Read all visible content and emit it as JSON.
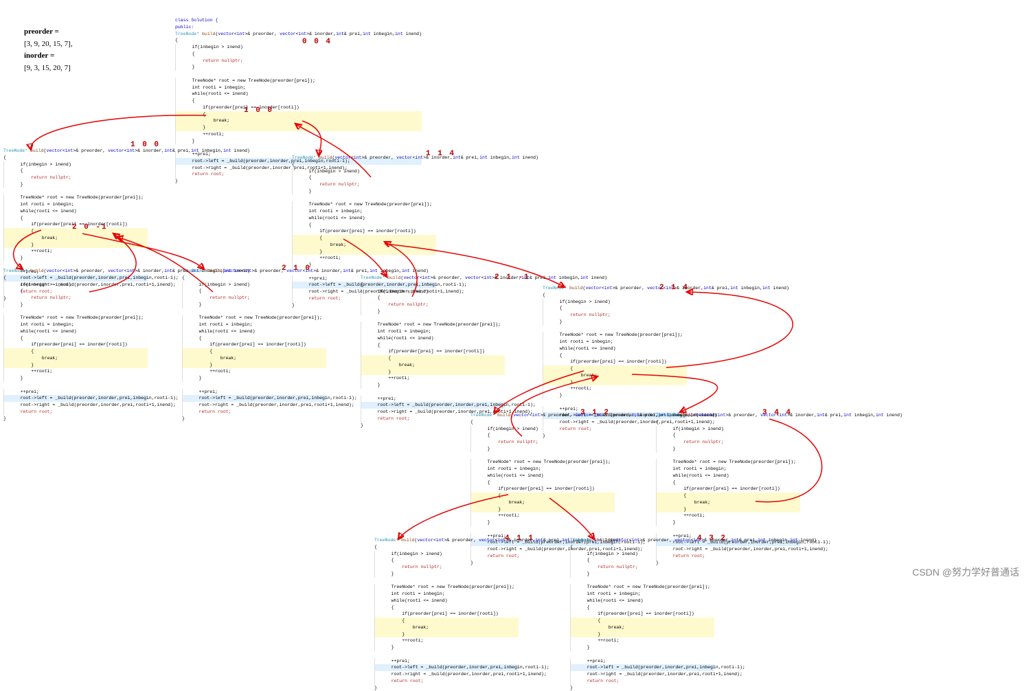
{
  "input": {
    "preorder_label": "preorder =",
    "preorder_value": "[3, 9, 20, 15, 7],",
    "inorder_label": "inorder =",
    "inorder_value": "[9, 3, 15, 20, 7]"
  },
  "class_decl": "class Solution {",
  "public_decl": "public:",
  "sig": "TreeNode* build(vector<int>& preorder, vector<int>& inorder,int& prei,int inbegin,int inend)",
  "lines": {
    "open": "{",
    "cond": "    if(inbegin > inend)",
    "open2": "    {",
    "retnull": "        return nullptr;",
    "close2": "    }",
    "newroot": "    TreeNode* root = new TreeNode(preorder[prei]);",
    "rooti": "    int rooti = inbegin;",
    "whl": "    while(rooti <= inend)",
    "open3": "    {",
    "ifcond": "        if(preorder[prei] == inorder[rooti])",
    "open4": "        {",
    "brk": "            break;",
    "close4": "        }",
    "inc": "        ++rooti;",
    "close3": "    }",
    "incp": "    ++prei;",
    "left": "    root->left = _build(preorder,inorder,prei,inbegin,rooti-1);",
    "right": "    root->right = _build(preorder,inorder,prei,rooti+1,inend);",
    "retroot": "    return root;",
    "close": "}"
  },
  "annotations": {
    "top_params": "0       0       4",
    "top_left": "1    0    0",
    "c1": "1    0    0",
    "c2": "2   0   -1",
    "c3": "2    1    0",
    "c4": "1    1    4",
    "c5": "2    1   -1",
    "c6": "2    1    4",
    "c7": "3    1    2",
    "c8": "3    4    4",
    "c9": "4    1    1",
    "c10": "4    3    2"
  },
  "watermark": "CSDN @努力学好普通话"
}
